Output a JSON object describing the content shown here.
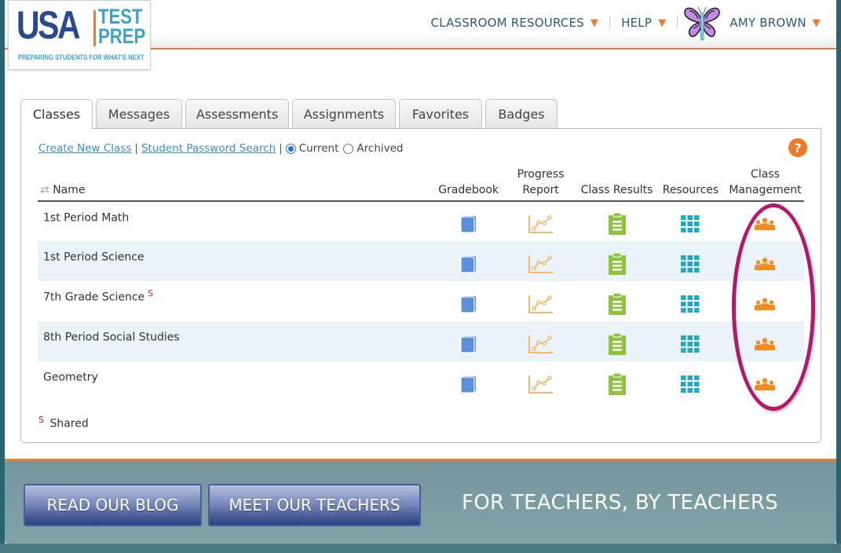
{
  "logo": {
    "brand": "USA",
    "brand2_line1": "TEST",
    "brand2_line2": "PREP",
    "tagline": "PREPARING STUDENTS FOR WHAT'S NEXT"
  },
  "topnav": {
    "classroom_resources": "CLASSROOM RESOURCES",
    "help": "HELP",
    "user": "AMY BROWN",
    "caret": "▼"
  },
  "tabs": [
    {
      "label": "Classes",
      "active": true
    },
    {
      "label": "Messages"
    },
    {
      "label": "Assessments"
    },
    {
      "label": "Assignments"
    },
    {
      "label": "Favorites"
    },
    {
      "label": "Badges"
    }
  ],
  "toolbar": {
    "create_new_class": "Create New Class",
    "student_password_search": "Student Password Search",
    "separator": "|",
    "filter_current": "Current",
    "filter_archived": "Archived",
    "selected_filter": "Current",
    "help_glyph": "?"
  },
  "table": {
    "headers": {
      "name": "Name",
      "gradebook": "Gradebook",
      "progress_report_1": "Progress",
      "progress_report_2": "Report",
      "class_results": "Class Results",
      "resources": "Resources",
      "class_management_1": "Class",
      "class_management_2": "Management"
    },
    "rows": [
      {
        "name": "1st Period Math",
        "shared": ""
      },
      {
        "name": "1st Period Science",
        "shared": ""
      },
      {
        "name": "7th Grade Science",
        "shared": "S"
      },
      {
        "name": "8th Period Social Studies",
        "shared": ""
      },
      {
        "name": "Geometry",
        "shared": ""
      }
    ]
  },
  "legend": {
    "marker": "S",
    "label": "Shared"
  },
  "footer": {
    "read_blog": "READ OUR BLOG",
    "meet_teachers": "MEET OUR TEACHERS",
    "tagline": "FOR TEACHERS, BY TEACHERS"
  },
  "colors": {
    "accent_orange": "#f07b2a",
    "link_blue": "#3b8ec6",
    "gradebook_blue": "#5b8fd9",
    "progress_orange": "#f7b66a",
    "results_green": "#8cc43c",
    "resources_teal": "#1ea9c6",
    "management_orange": "#f58a1f",
    "highlight_magenta": "#b5176d"
  }
}
